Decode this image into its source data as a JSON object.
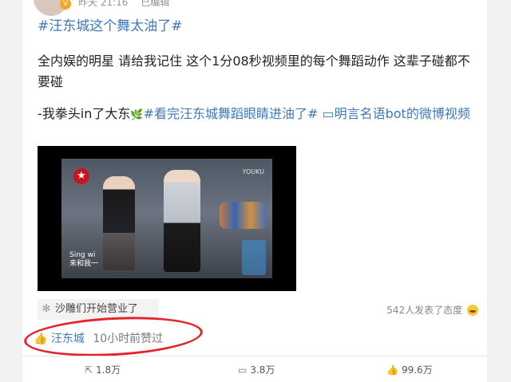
{
  "post": {
    "time": "昨天 21:16",
    "edited": "已编辑",
    "hashtag": "#汪东城这个舞太油了#",
    "body": "全内娱的明星 请给我记住 这个1分08秒视频里的每个舞蹈动作 这辈子碰都不要碰",
    "signoff": "-我拳头in了大东",
    "topic_link": "#看完汪东城舞蹈眼睛进油了#",
    "video_link": "明言名语bot的微博视频"
  },
  "video": {
    "watermark": "YOUKU",
    "subtitle_top": "Sing wi",
    "subtitle_bottom": "来和我一"
  },
  "app_tag": "沙雕们开始营业了",
  "reactions": "542人发表了态度",
  "liked": {
    "user": "汪东城",
    "time": "10小时前赞过"
  },
  "actions": {
    "repost": "1.8万",
    "comment": "3.8万",
    "like": "99.6万"
  },
  "icons": [
    "verified-badge-icon",
    "leaf-icon",
    "video-link-icon",
    "app-gear-icon",
    "laugh-emoji-icon",
    "thumb-up-icon",
    "repost-icon",
    "comment-icon",
    "like-icon"
  ],
  "colors": {
    "link": "#3e79b8",
    "annotation": "#e3242b"
  }
}
